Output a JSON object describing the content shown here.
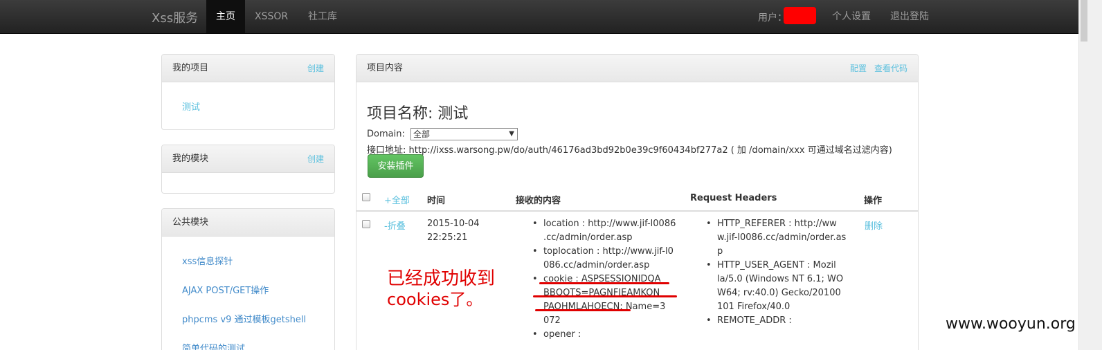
{
  "navbar": {
    "brand": "Xss服务",
    "items": [
      "主页",
      "XSSOR",
      "社工库"
    ],
    "user_label": "用户：",
    "settings": "个人设置",
    "logout": "退出登陆"
  },
  "sidebar": {
    "my_projects": {
      "title": "我的项目",
      "action": "创建",
      "items": [
        "测试"
      ]
    },
    "my_modules": {
      "title": "我的模块",
      "action": "创建"
    },
    "public_modules": {
      "title": "公共模块",
      "items": [
        "xss信息探针",
        "AJAX POST/GET操作",
        "phpcms v9 通过模板getshell",
        "简单代码的测试"
      ]
    }
  },
  "main": {
    "heading": "项目内容",
    "config": "配置",
    "view_code": "查看代码",
    "project_title": "项目名称: 测试",
    "domain_label": "Domain:",
    "domain_selected": "全部",
    "api_label": "接口地址:",
    "api_url": "http://ixss.warsong.pw/do/auth/46176ad3bd92b0e39c9f60434bf277a2 ( 加 /domain/xxx 可通过域名过滤内容)",
    "install_button": "安装插件",
    "table": {
      "headers": {
        "expand": "+全部",
        "time": "时间",
        "content": "接收的内容",
        "request_headers": "Request Headers",
        "actions": "操作"
      },
      "row": {
        "toggle": "-折叠",
        "date": "2015-10-04",
        "time": "22:25:21",
        "content": [
          [
            "location : http://www.jif-l0086",
            ".cc/admin/order.asp"
          ],
          [
            "toplocation : http://www.jif-l0",
            "086.cc/admin/order.asp"
          ],
          [
            "cookie : ASPSESSIONIDQA",
            "BBQQTS=PAGNFIEAMKON",
            "PAOHMLAHOECN; Name=3",
            "072"
          ],
          [
            "opener :"
          ]
        ],
        "headers": [
          [
            "HTTP_REFERER : http://ww",
            "w.jif-l0086.cc/admin/order.as",
            "p"
          ],
          [
            "HTTP_USER_AGENT : Mozil",
            "la/5.0 (Windows NT 6.1; WO",
            "W64; rv:40.0) Gecko/20100",
            "101 Firefox/40.0"
          ],
          [
            "REMOTE_ADDR :"
          ]
        ],
        "delete": "删除"
      }
    }
  },
  "annotation": {
    "line1": "已经成功收到",
    "line2": "cookies了。"
  },
  "watermark": "www.wooyun.org",
  "colors": {
    "navbar": "#222222",
    "link": "#5bc0de",
    "button": "#5cb85c",
    "annotation": "#e00000",
    "redaction": "#ff0000"
  }
}
